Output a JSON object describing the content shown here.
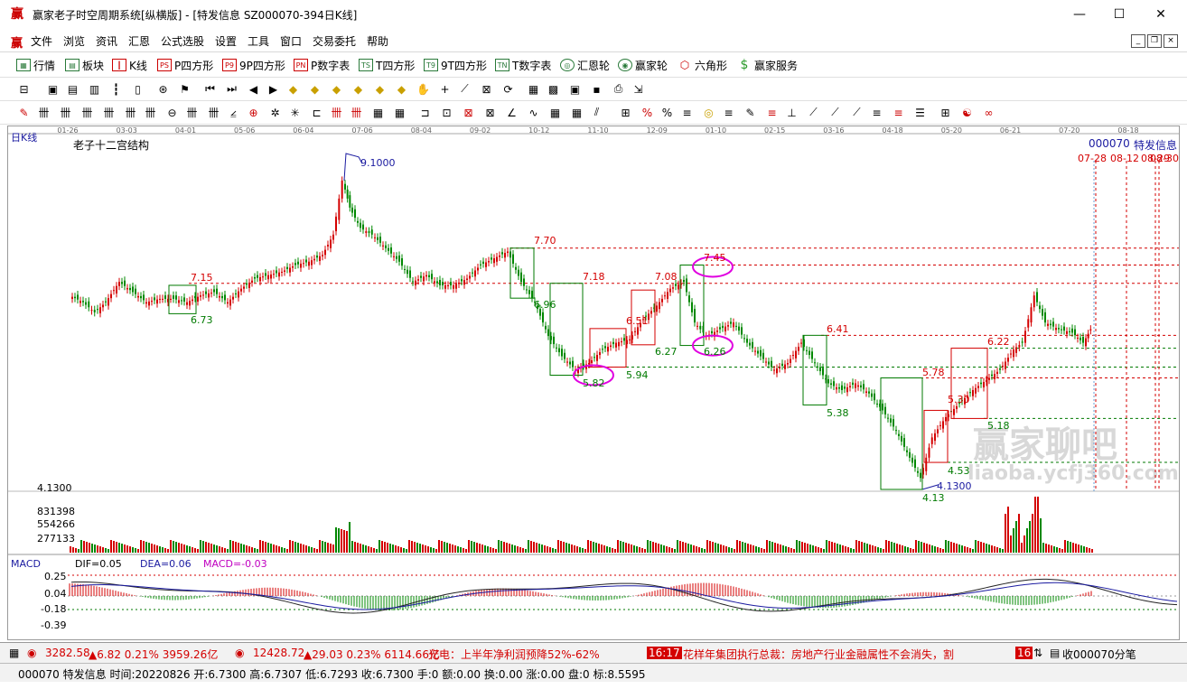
{
  "window": {
    "title": "赢家老子时空周期系统[纵横版] - [特发信息  SZ000070-394日K线]",
    "minimize": "—",
    "maximize": "☐",
    "close": "✕"
  },
  "menu": [
    "文件",
    "浏览",
    "资讯",
    "汇恩",
    "公式选股",
    "设置",
    "工具",
    "窗口",
    "交易委托",
    "帮助"
  ],
  "toolbar1": [
    {
      "label": "行情",
      "icon": "grid-icon"
    },
    {
      "label": "板块",
      "icon": "blocks-icon"
    },
    {
      "label": "K线",
      "icon": "kline-icon"
    },
    {
      "label": "P四方形",
      "icon": "P"
    },
    {
      "label": "9P四方形",
      "icon": "9P"
    },
    {
      "label": "P数字表",
      "icon": "PN"
    },
    {
      "label": "T四方形",
      "icon": "TS"
    },
    {
      "label": "9T四方形",
      "icon": "T9"
    },
    {
      "label": "T数字表",
      "icon": "TN"
    },
    {
      "label": "汇恩轮",
      "icon": "wheel-icon"
    },
    {
      "label": "赢家轮",
      "icon": "wheel2-icon"
    },
    {
      "label": "六角形",
      "icon": "hexagon-icon"
    },
    {
      "label": "赢家服务",
      "icon": "dollar-icon"
    }
  ],
  "chart": {
    "period_label": "日K线",
    "indicator_title": "老子十二宫结构",
    "stock_code": "000070",
    "stock_name": "特发信息",
    "future_dates": [
      "07-28",
      "08-12",
      "08-29",
      "08-30"
    ],
    "x_dates": [
      "01-26",
      "03-03",
      "04-01",
      "05-06",
      "06-04",
      "07-06",
      "08-04",
      "09-02",
      "10-12",
      "11-10",
      "12-09",
      "01-10",
      "02-15",
      "03-16",
      "04-18",
      "05-20",
      "06-21",
      "07-20",
      "08-18"
    ],
    "price_high": "9.1000",
    "price_low": "4.1300",
    "price_low_label": "4.1300",
    "low_mark": "4.13",
    "axis_price": "4.1300",
    "volume_ticks": [
      "831398",
      "554266",
      "277133"
    ],
    "price_levels": [
      "7.70",
      "7.18",
      "7.45",
      "7.15",
      "6.73",
      "6.96",
      "6.51",
      "6.27",
      "6.26",
      "5.82",
      "5.94",
      "7.08",
      "6.41",
      "5.38",
      "6.22",
      "5.78",
      "5.30",
      "5.18",
      "4.53"
    ],
    "macd": {
      "title": "MACD",
      "dif": "DIF=0.05",
      "dea": "DEA=0.06",
      "macd": "MACD=-0.03",
      "ticks": [
        "0.25",
        "0.04",
        "-0.18",
        "-0.39"
      ]
    },
    "watermark": "赢家聊吧",
    "watermark_url": "liaoba.ycfj360.com"
  },
  "chart_data": {
    "type": "candlestick",
    "title": "老子十二宫结构",
    "x": [
      "01-26",
      "03-03",
      "04-01",
      "05-06",
      "06-04",
      "07-06",
      "08-04",
      "09-02",
      "10-12",
      "11-10",
      "12-09",
      "01-10",
      "02-15",
      "03-16",
      "04-18",
      "05-20",
      "06-21",
      "07-20"
    ],
    "close": [
      6.95,
      6.9,
      6.8,
      6.9,
      7.2,
      8.2,
      7.4,
      7.2,
      6.9,
      6.1,
      6.4,
      6.8,
      6.3,
      6.0,
      4.9,
      5.9,
      6.5,
      6.6
    ],
    "high": 9.1,
    "low": 4.13,
    "macd_dif": 0.05,
    "macd_dea": 0.06,
    "macd_hist": -0.03,
    "volume_ticks": [
      831398,
      554266,
      277133
    ]
  },
  "status_bar": {
    "sh_index": "3282.58",
    "sh_change": "▲6.82 0.21% 3959.26亿",
    "sz_index": "12428.72",
    "sz_change": "▲29.03 0.23% 6114.66亿",
    "news1": "光电：上半年净利润预降52%-62%",
    "news_time": "16:17",
    "news2": "花样年集团执行总裁：房地产行业金融属性不会消失，割",
    "news_time2": "16",
    "shou": "收000070分笔"
  },
  "quote_bar": {
    "text": "000070 特发信息 时间:20220826 开:6.7300 高:6.7307 低:6.7293 收:6.7300 手:0 额:0.00 换:0.00 涨:0.00 盘:0 标:8.5595"
  }
}
